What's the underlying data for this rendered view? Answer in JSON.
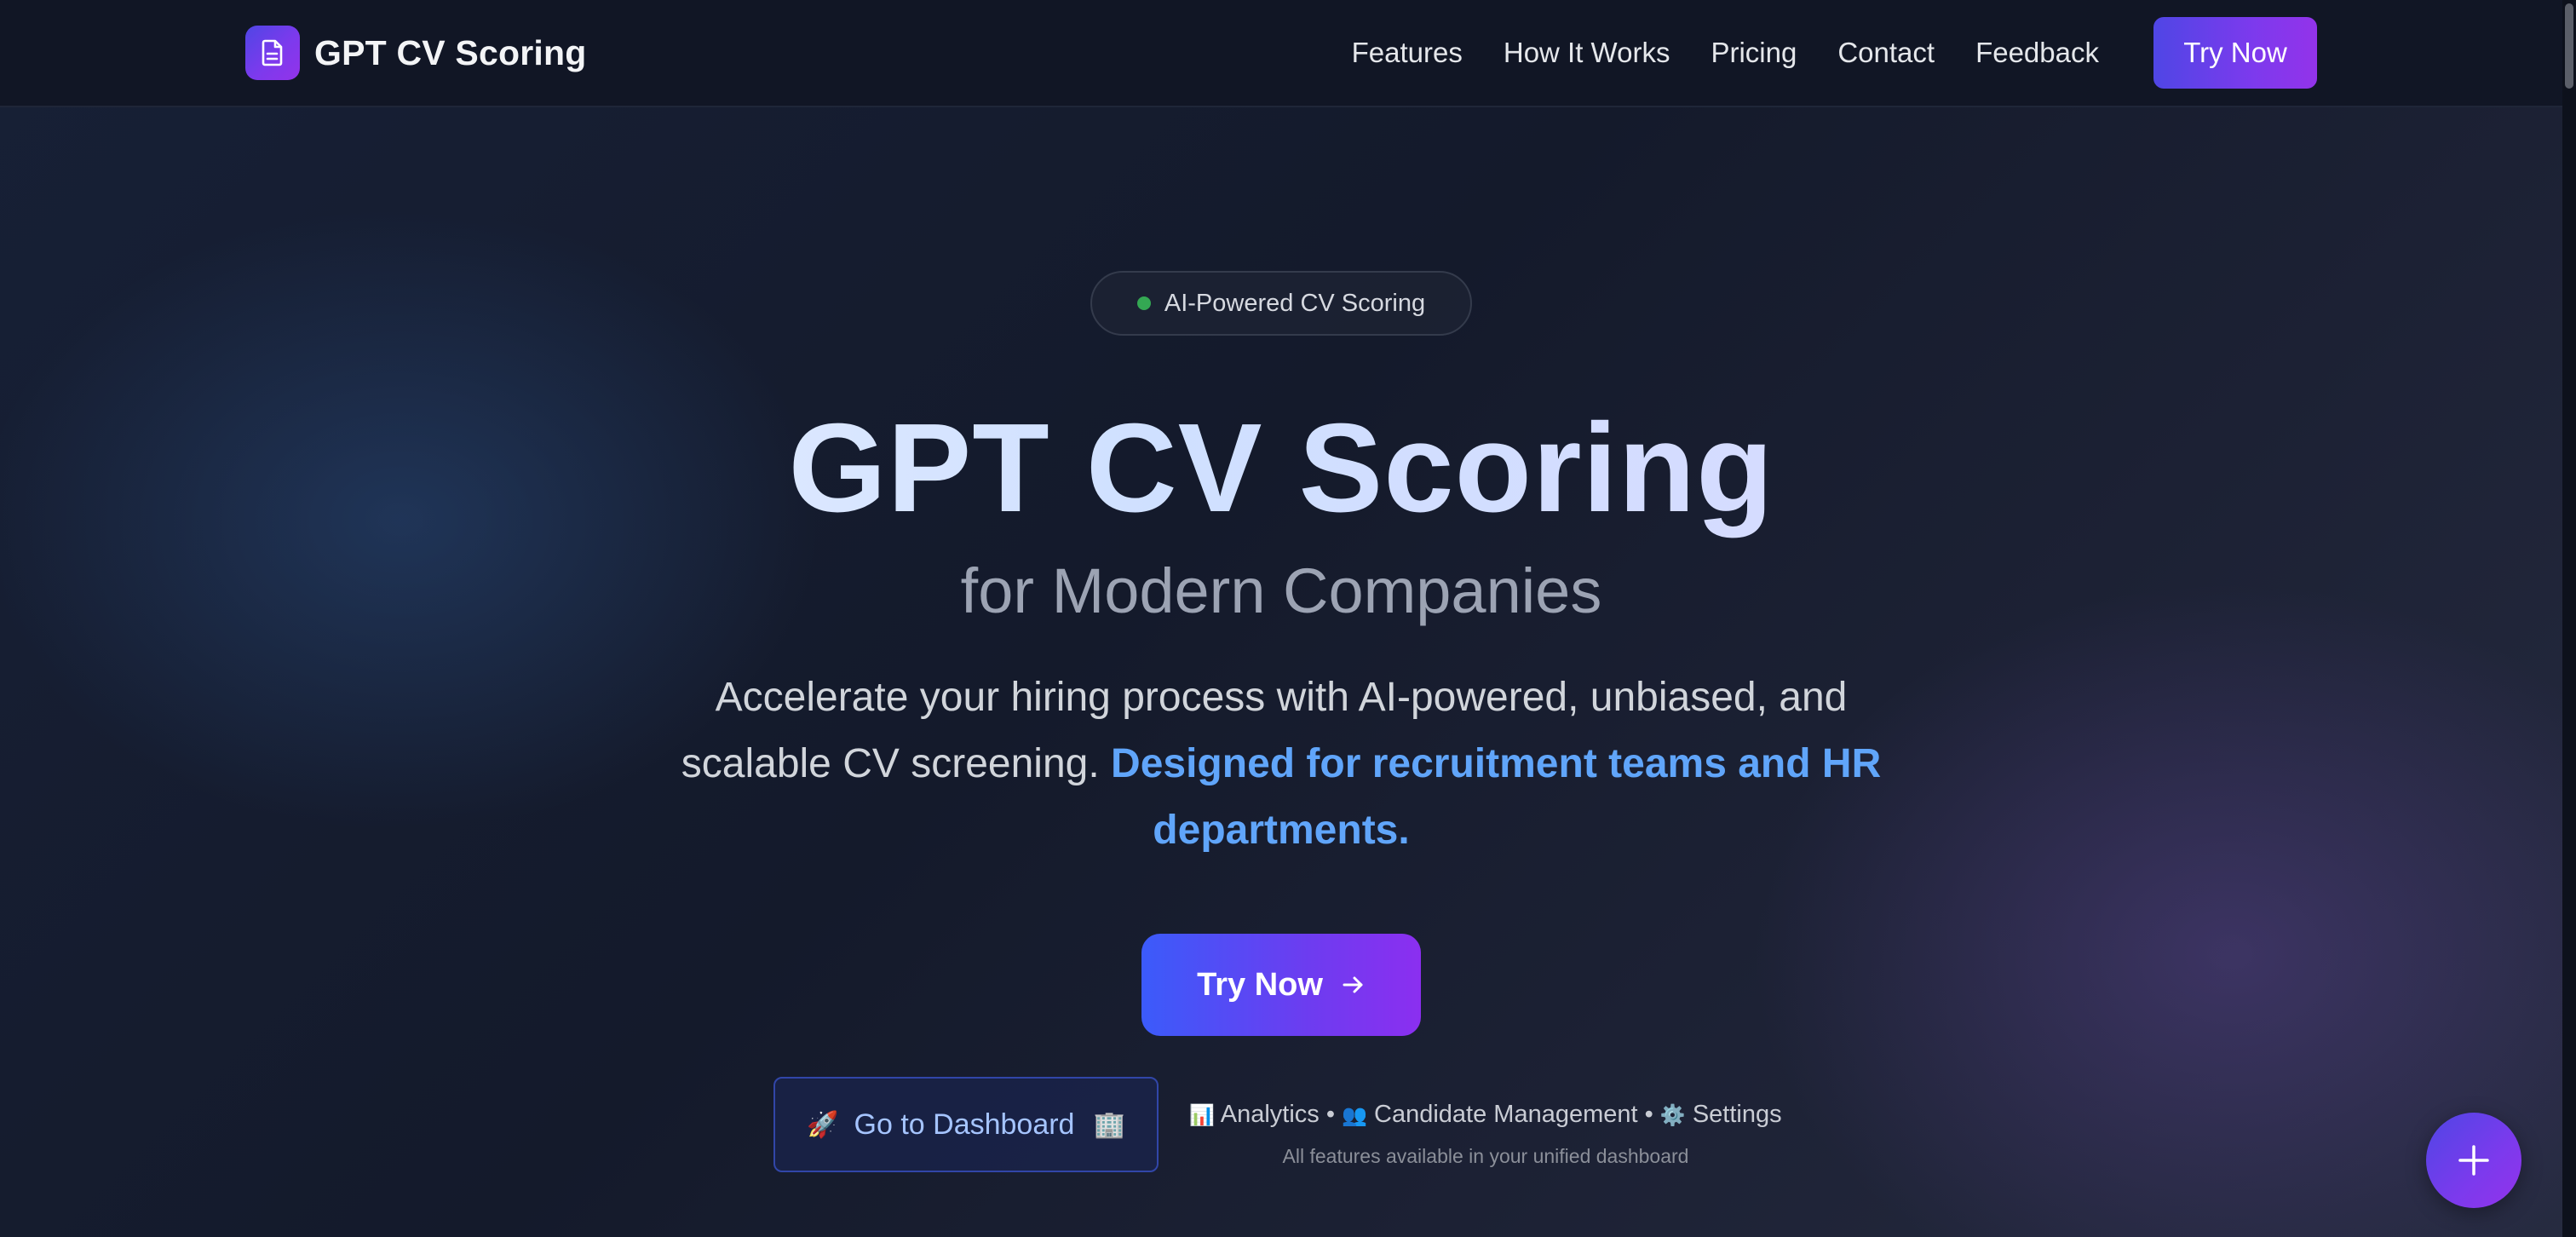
{
  "nav": {
    "brand": "GPT CV Scoring",
    "brand_icon": "document-icon",
    "links": [
      "Features",
      "How It Works",
      "Pricing",
      "Contact",
      "Feedback"
    ],
    "cta": "Try Now"
  },
  "hero": {
    "badge": "AI-Powered CV Scoring",
    "badge_dot_color": "#34a853",
    "title": "GPT CV Scoring",
    "subtitle": "for Modern Companies",
    "description": "Accelerate your hiring process with AI-powered, unbiased, and scalable CV screening.",
    "description_highlight": "Designed for recruitment teams and HR departments.",
    "cta": "Try Now",
    "cta_icon": "arrow-right-icon"
  },
  "dashboard": {
    "button_emoji": "🚀",
    "button_label": "Go to Dashboard",
    "button_trailing_emoji": "🏢",
    "features": [
      {
        "emoji": "📊",
        "label": "Analytics"
      },
      {
        "emoji": "👥",
        "label": "Candidate Management"
      },
      {
        "emoji": "⚙️",
        "label": "Settings"
      }
    ],
    "separator": "•",
    "note": "All features available in your unified dashboard"
  },
  "fab": {
    "icon": "plus-icon"
  },
  "colors": {
    "accent_start": "#4f46e5",
    "accent_end": "#9333ea",
    "highlight": "#60a5fa",
    "nav_bg": "#111625"
  }
}
